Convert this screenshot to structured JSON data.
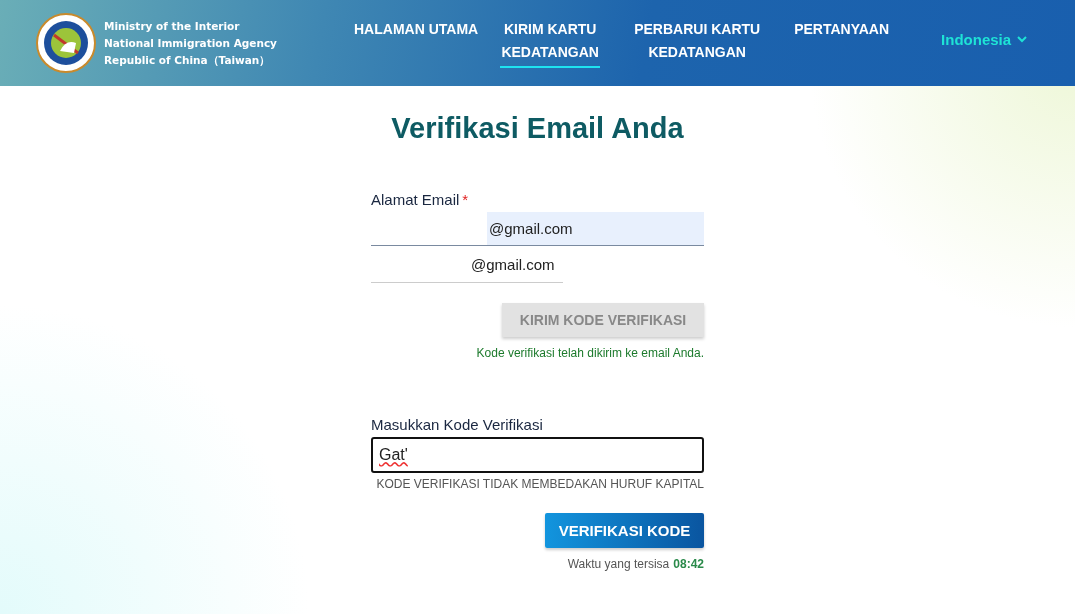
{
  "header": {
    "agency_lines": [
      "Ministry of the Interior",
      "National Immigration Agency",
      "Republic of China（Taiwan）"
    ],
    "nav": [
      {
        "label": "HALAMAN UTAMA",
        "selected": false
      },
      {
        "label": "KIRIM KARTU KEDATANGAN",
        "selected": true
      },
      {
        "label": "PERBARUI KARTU KEDATANGAN",
        "selected": false
      },
      {
        "label": "PERTANYAAN",
        "selected": false
      }
    ],
    "language": "Indonesia"
  },
  "page_title": "Verifikasi Email Anda",
  "email": {
    "label": "Alamat Email",
    "required_mark": "*",
    "value": "@gmail.com",
    "confirm_value": "@gmail.com"
  },
  "send_button": {
    "label": "KIRIM KODE VERIFIKASI",
    "disabled": true
  },
  "sent_message": "Kode verifikasi telah dikirim ke email Anda.",
  "code": {
    "label": "Masukkan Kode Verifikasi",
    "value": "Gat'",
    "hint": "KODE VERIFIKASI TIDAK MEMBEDAKAN HURUF KAPITAL"
  },
  "verify_button": {
    "label": "VERIFIKASI KODE"
  },
  "timer": {
    "label": "Waktu yang tersisa",
    "value": "08:42"
  }
}
